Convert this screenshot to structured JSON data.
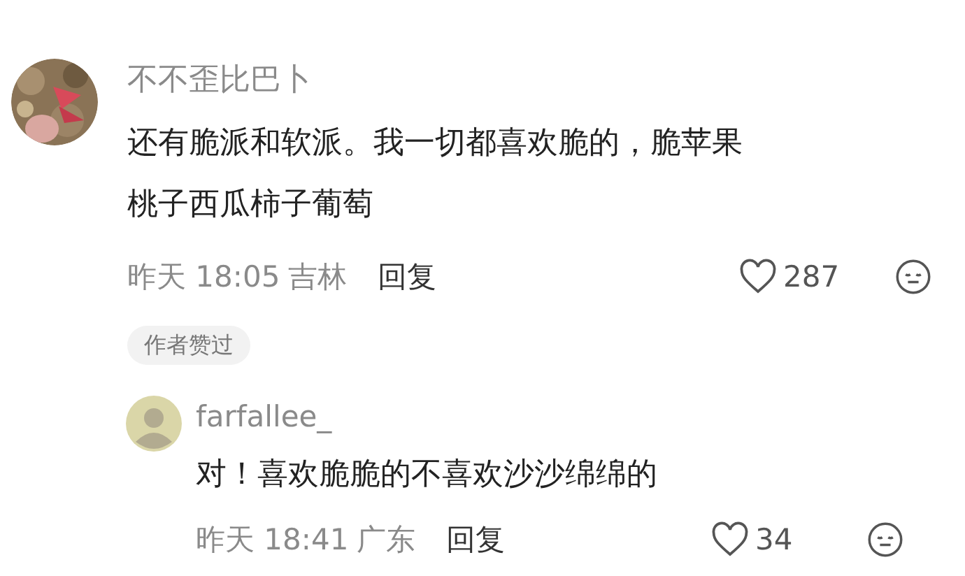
{
  "comment": {
    "username": "不不歪比巴卜",
    "text": "还有脆派和软派。我一切都喜欢脆的，脆苹果桃子西瓜柿子葡萄",
    "time": "昨天 18:05",
    "location": "吉林",
    "reply_label": "回复",
    "likes": "287",
    "badge": "作者赞过"
  },
  "replies": [
    {
      "username": "farfallee_",
      "text": "对！喜欢脆脆的不喜欢沙沙绵绵的",
      "time": "昨天 18:41",
      "location": "广东",
      "reply_label": "回复",
      "likes": "34"
    }
  ]
}
